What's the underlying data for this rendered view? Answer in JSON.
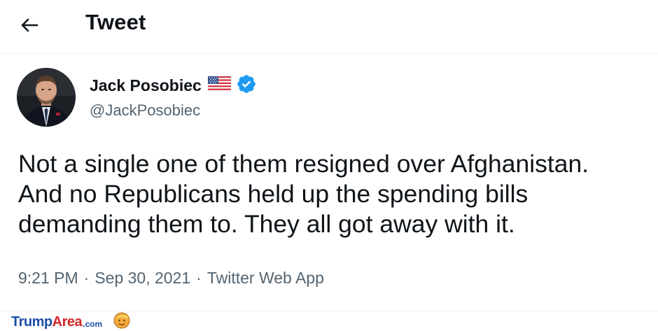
{
  "header": {
    "title": "Tweet",
    "back_icon": "arrow-left-icon"
  },
  "author": {
    "name": "Jack Posobiec",
    "handle": "@JackPosobiec",
    "flag_icon": "us-flag-icon",
    "verified_icon": "verified-badge-icon",
    "verified_color": "#1d9bf0"
  },
  "tweet": {
    "text": "Not a single one of them resigned over Afghanistan.\nAnd no Republicans held up the spending bills\ndemanding them to. They all got away with it.",
    "time": "9:21 PM",
    "date": "Sep 30, 2021",
    "source": "Twitter Web App",
    "separator": "·"
  },
  "watermark": {
    "brand_part1": "Trump",
    "brand_part2": "Area",
    "brand_suffix": ".com",
    "mascot_icon": "trump-face-icon"
  },
  "colors": {
    "text_primary": "#0f1419",
    "text_secondary": "#536471",
    "divider": "#eff3f4",
    "brand_blue": "#1d4ea8",
    "brand_red": "#d32626"
  }
}
